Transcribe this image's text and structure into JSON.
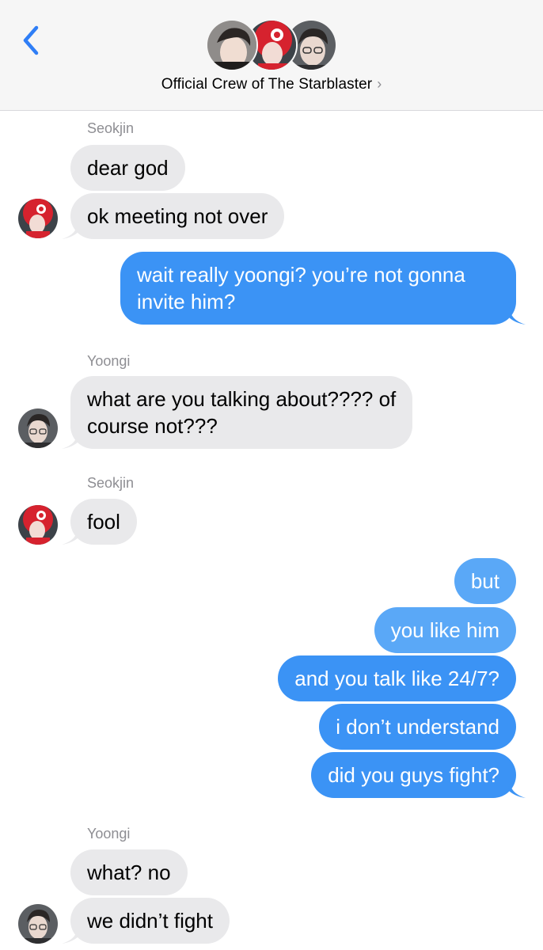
{
  "header": {
    "back_icon": "chevron-left-icon",
    "group_name": "Official Crew of The Starblaster",
    "chevron": "›",
    "accent": "#2f7ef6"
  },
  "messages": [
    {
      "sender": "Seokjin"
    },
    {
      "text": "dear god"
    },
    {
      "text": "ok meeting not over"
    },
    {
      "text_line1": "wait really yoongi? you’re not gonna",
      "text_line2": "invite him?"
    },
    {
      "sender": "Yoongi"
    },
    {
      "text_line1": "what are you talking about???? of",
      "text_line2": "course not???"
    },
    {
      "sender": "Seokjin"
    },
    {
      "text": "fool"
    },
    {
      "text": "but"
    },
    {
      "text": "you like him"
    },
    {
      "text": "and you talk like 24/7?"
    },
    {
      "text": "i don’t understand"
    },
    {
      "text": "did you guys fight?"
    },
    {
      "sender": "Yoongi"
    },
    {
      "text": "what? no"
    },
    {
      "text": "we didn’t fight"
    }
  ],
  "colors": {
    "incoming": "#e9e9eb",
    "outgoing": "#3b93f5",
    "outgoing_light": "#5aa8f7",
    "sender_label": "#8e8e93"
  }
}
